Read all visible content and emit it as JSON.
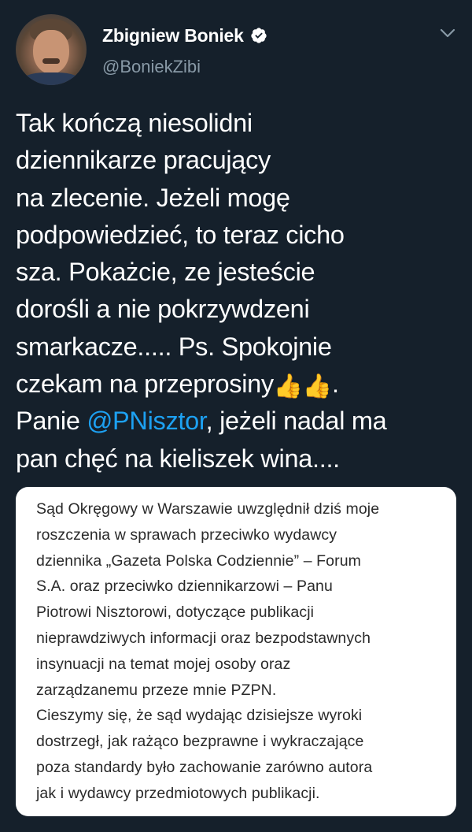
{
  "user": {
    "display_name": "Zbigniew Boniek",
    "handle": "@BoniekZibi",
    "verified": true
  },
  "tweet": {
    "lines": [
      "Tak kończą niesolidni",
      "dziennikarze pracujący",
      "na zlecenie. Jeżeli mogę",
      "podpowiedzieć, to teraz cicho",
      "sza. Pokażcie, ze jesteście",
      "dorośli a nie pokrzywdzeni",
      "smarkacze..... Ps. Spokojnie"
    ],
    "line8_text": "czekam na przeprosiny",
    "line8_emoji": "👍👍",
    "line8_end": ".",
    "line9_prefix": "Panie ",
    "line9_mention": "@PNisztor",
    "line9_suffix": ", jeżeli nadal ma",
    "line10": "pan chęć na kieliszek wina...."
  },
  "card": {
    "lines": [
      "Sąd Okręgowy w Warszawie uwzględnił dziś moje",
      "roszczenia w sprawach przeciwko wydawcy",
      "dziennika „Gazeta Polska Codziennie” – Forum",
      "S.A. oraz przeciwko dziennikarzowi – Panu",
      "Piotrowi Nisztorowi, dotyczące publikacji",
      "nieprawdziwych informacji oraz bezpodstawnych",
      "insynuacji na temat mojej osoby oraz",
      "zarządzanemu przeze mnie PZPN.",
      "Cieszymy się, że sąd wydając dzisiejsze wyroki",
      "dostrzegł, jak rażąco bezprawne i wykraczające",
      "poza standardy było zachowanie zarówno autora",
      "jak i wydawcy przedmiotowych publikacji."
    ]
  },
  "icons": {
    "verified": "verified-badge-icon",
    "chevron": "chevron-down-icon"
  },
  "colors": {
    "background": "#15202b",
    "link": "#1da1f2",
    "secondary_text": "#8899a6",
    "card_background": "#ffffff"
  }
}
